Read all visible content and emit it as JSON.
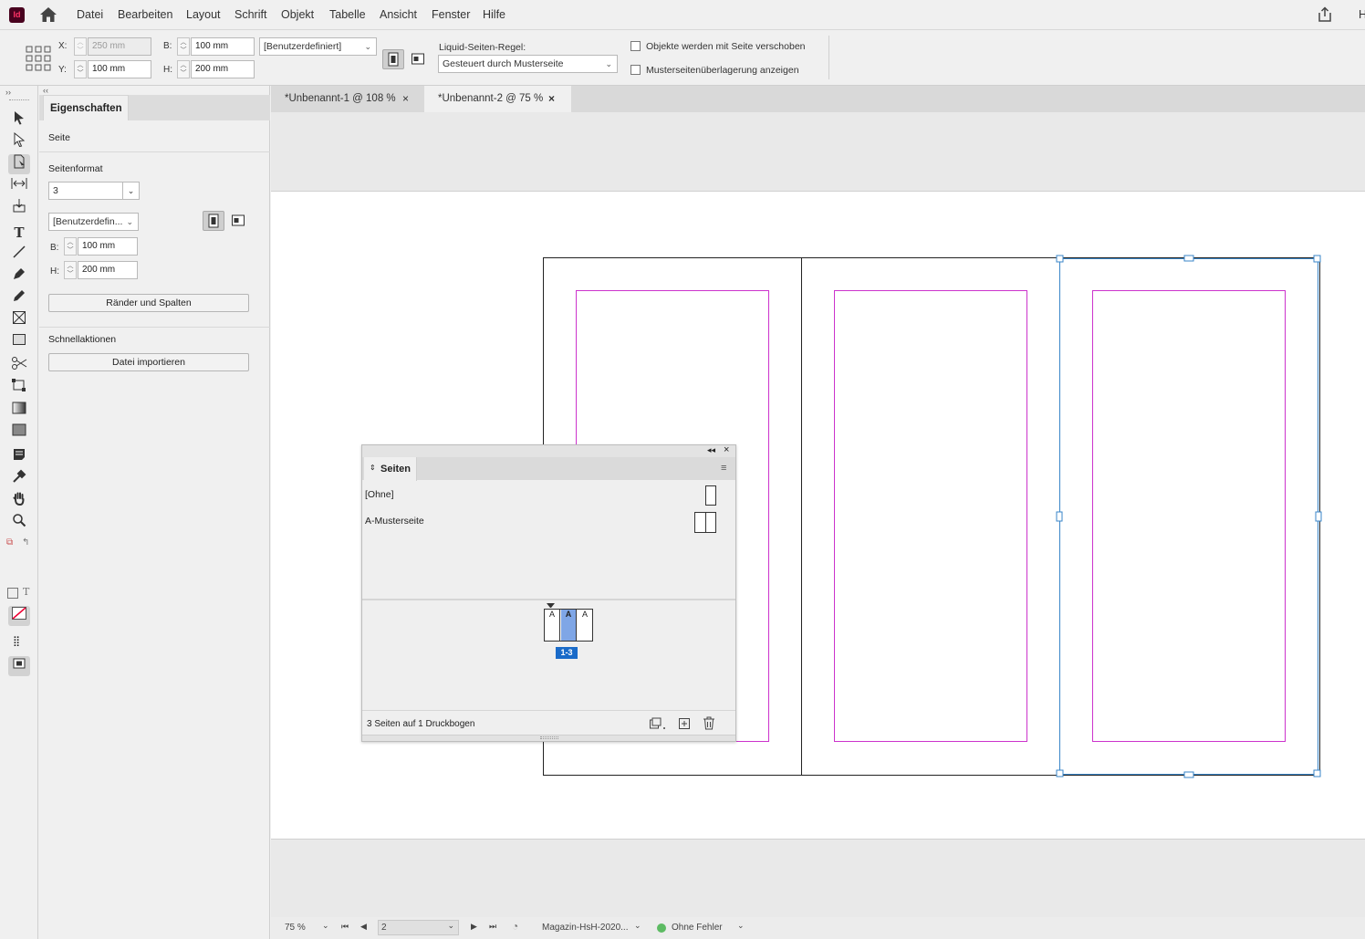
{
  "app": {
    "logo": "Id"
  },
  "menu": [
    "Datei",
    "Bearbeiten",
    "Layout",
    "Schrift",
    "Objekt",
    "Tabelle",
    "Ansicht",
    "Fenster",
    "Hilfe"
  ],
  "menu_right": "H",
  "control": {
    "x_label": "X:",
    "x_value": "250 mm",
    "y_label": "Y:",
    "y_value": "100 mm",
    "b_label": "B:",
    "b_value": "100 mm",
    "h_label": "H:",
    "h_value": "200 mm",
    "preset": "[Benutzerdefiniert]",
    "liquid_label": "Liquid-Seiten-Regel:",
    "liquid_value": "Gesteuert durch Musterseite",
    "chk_move_objects": "Objekte werden mit Seite verschoben",
    "chk_master_overlay": "Musterseitenüberlagerung anzeigen"
  },
  "props": {
    "tab": "Eigenschaften",
    "section_page": "Seite",
    "format_title": "Seitenformat",
    "page_value": "3",
    "preset": "[Benutzerdefin...",
    "b_label": "B:",
    "b_value": "100 mm",
    "h_label": "H:",
    "h_value": "200 mm",
    "margins_button": "Ränder und Spalten",
    "quick_title": "Schnellaktionen",
    "import_button": "Datei importieren"
  },
  "tabs": [
    {
      "label": "*Unbenannt-1 @ 108 %",
      "close": "×"
    },
    {
      "label": "*Unbenannt-2 @ 75 %",
      "close": "×"
    }
  ],
  "pages_panel": {
    "title": "Seiten",
    "masters": [
      "[Ohne]",
      "A-Musterseite"
    ],
    "page_letters": [
      "A",
      "A",
      "A"
    ],
    "spread_label": "1-3",
    "footer": "3 Seiten auf 1 Druckbogen"
  },
  "status": {
    "zoom": "75 %",
    "page": "2",
    "profile": "Magazin-HsH-2020...",
    "preflight": "Ohne Fehler"
  },
  "colors": {
    "margin_guide": "#cc33cc",
    "selection": "#3a86c8",
    "spread_badge": "#1a6bc9",
    "preflight_ok": "#5dbb63"
  }
}
